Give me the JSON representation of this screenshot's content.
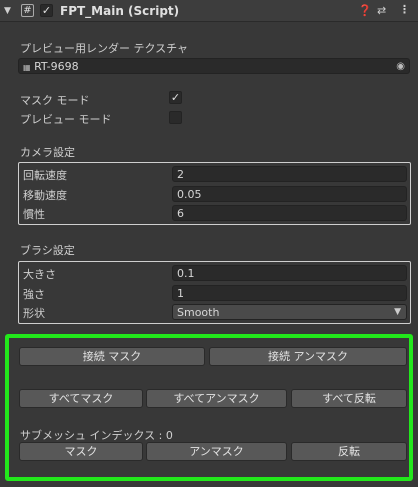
{
  "header": {
    "title": "FPT_Main (Script)",
    "enabled": true,
    "hash_icon": "#"
  },
  "preview_texture": {
    "label": "プレビュー用レンダー テクスチャ",
    "value": "RT-9698"
  },
  "mask_mode": {
    "label": "マスク モード",
    "checked": true
  },
  "preview_mode": {
    "label": "プレビュー モード",
    "checked": false
  },
  "camera": {
    "section_label": "カメラ設定",
    "rotation_speed_label": "回転速度",
    "rotation_speed_value": "2",
    "move_speed_label": "移動速度",
    "move_speed_value": "0.05",
    "inertia_label": "慣性",
    "inertia_value": "6"
  },
  "brush": {
    "section_label": "ブラシ設定",
    "size_label": "大きさ",
    "size_value": "0.1",
    "strength_label": "強さ",
    "strength_value": "1",
    "shape_label": "形状",
    "shape_value": "Smooth"
  },
  "buttons": {
    "connect_mask": "接続 マスク",
    "connect_unmask": "接続 アンマスク",
    "mask_all": "すべてマスク",
    "unmask_all": "すべてアンマスク",
    "invert_all": "すべて反転",
    "mask": "マスク",
    "unmask": "アンマスク",
    "invert": "反転"
  },
  "submesh": {
    "label": "サブメッシュ インデックス : 0"
  },
  "colors": {
    "highlight": "#22e81b",
    "background": "#383838",
    "field": "#2a2a2a",
    "button": "#585858"
  }
}
